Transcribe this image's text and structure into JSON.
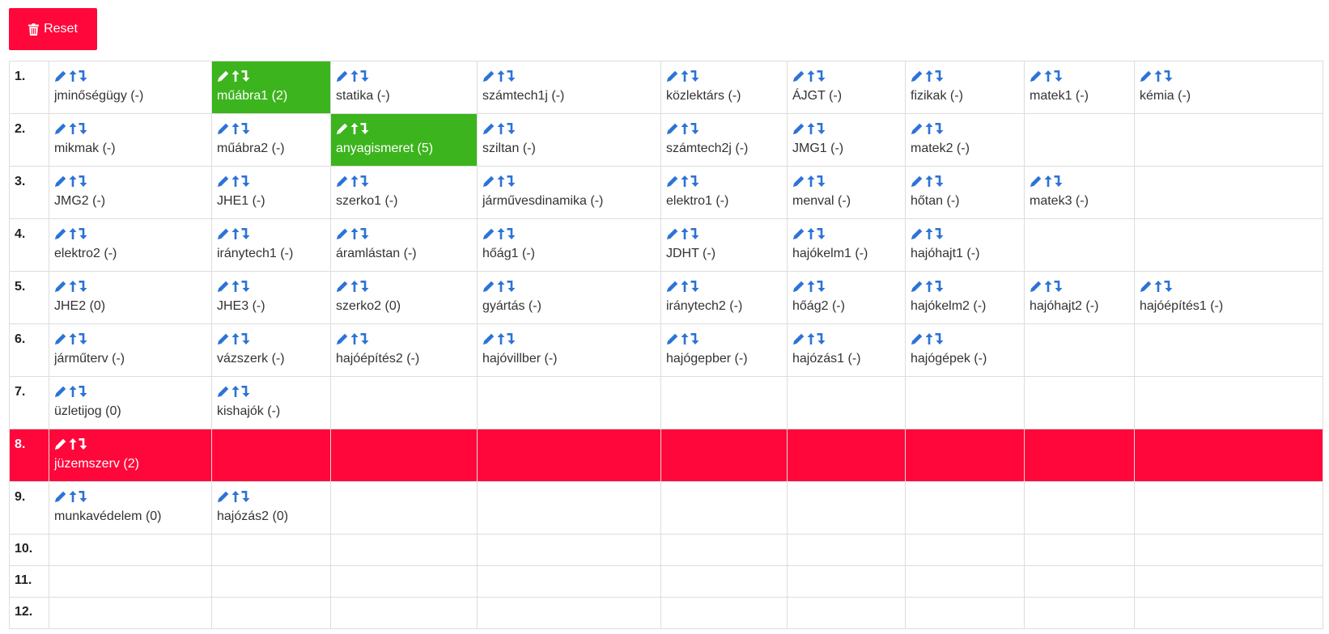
{
  "toolbar": {
    "reset_label": "Reset",
    "reset_color": "#ff073a"
  },
  "colors": {
    "active": "#3cb41d",
    "alert": "#ff073a",
    "icon": "#2c73d6",
    "border": "#dddddd"
  },
  "icons": [
    "pencil-icon",
    "move-up-icon",
    "move-down-icon",
    "trash-icon"
  ],
  "rows": [
    {
      "num": "1.",
      "state": "normal",
      "cells": [
        {
          "name": "jminőségügy",
          "count": "(-)",
          "state": "normal"
        },
        {
          "name": "műábra1",
          "count": "(2)",
          "state": "active"
        },
        {
          "name": "statika",
          "count": "(-)",
          "state": "normal"
        },
        {
          "name": "számtech1j",
          "count": "(-)",
          "state": "normal"
        },
        {
          "name": "közlektárs",
          "count": "(-)",
          "state": "normal"
        },
        {
          "name": "ÁJGT",
          "count": "(-)",
          "state": "normal"
        },
        {
          "name": "fizikak",
          "count": "(-)",
          "state": "normal"
        },
        {
          "name": "matek1",
          "count": "(-)",
          "state": "normal"
        },
        {
          "name": "kémia",
          "count": "(-)",
          "state": "normal"
        }
      ]
    },
    {
      "num": "2.",
      "state": "normal",
      "cells": [
        {
          "name": "mikmak",
          "count": "(-)",
          "state": "normal"
        },
        {
          "name": "műábra2",
          "count": "(-)",
          "state": "normal"
        },
        {
          "name": "anyagismeret",
          "count": "(5)",
          "state": "active"
        },
        {
          "name": "sziltan",
          "count": "(-)",
          "state": "normal"
        },
        {
          "name": "számtech2j",
          "count": "(-)",
          "state": "normal"
        },
        {
          "name": "JMG1",
          "count": "(-)",
          "state": "normal"
        },
        {
          "name": "matek2",
          "count": "(-)",
          "state": "normal"
        }
      ]
    },
    {
      "num": "3.",
      "state": "normal",
      "cells": [
        {
          "name": "JMG2",
          "count": "(-)",
          "state": "normal"
        },
        {
          "name": "JHE1",
          "count": "(-)",
          "state": "normal"
        },
        {
          "name": "szerko1",
          "count": "(-)",
          "state": "normal"
        },
        {
          "name": "járművesdinamika",
          "count": "(-)",
          "state": "normal"
        },
        {
          "name": "elektro1",
          "count": "(-)",
          "state": "normal"
        },
        {
          "name": "menval",
          "count": "(-)",
          "state": "normal"
        },
        {
          "name": "hőtan",
          "count": "(-)",
          "state": "normal"
        },
        {
          "name": "matek3",
          "count": "(-)",
          "state": "normal"
        }
      ]
    },
    {
      "num": "4.",
      "state": "normal",
      "cells": [
        {
          "name": "elektro2",
          "count": "(-)",
          "state": "normal"
        },
        {
          "name": "iránytech1",
          "count": "(-)",
          "state": "normal"
        },
        {
          "name": "áramlástan",
          "count": "(-)",
          "state": "normal"
        },
        {
          "name": "hőág1",
          "count": "(-)",
          "state": "normal"
        },
        {
          "name": "JDHT",
          "count": "(-)",
          "state": "normal"
        },
        {
          "name": "hajókelm1",
          "count": "(-)",
          "state": "normal"
        },
        {
          "name": "hajóhajt1",
          "count": "(-)",
          "state": "normal"
        }
      ]
    },
    {
      "num": "5.",
      "state": "normal",
      "cells": [
        {
          "name": "JHE2",
          "count": "(0)",
          "state": "normal"
        },
        {
          "name": "JHE3",
          "count": "(-)",
          "state": "normal"
        },
        {
          "name": "szerko2",
          "count": "(0)",
          "state": "normal"
        },
        {
          "name": "gyártás",
          "count": "(-)",
          "state": "normal"
        },
        {
          "name": "iránytech2",
          "count": "(-)",
          "state": "normal"
        },
        {
          "name": "hőág2",
          "count": "(-)",
          "state": "normal"
        },
        {
          "name": "hajókelm2",
          "count": "(-)",
          "state": "normal"
        },
        {
          "name": "hajóhajt2",
          "count": "(-)",
          "state": "normal"
        },
        {
          "name": "hajóépítés1",
          "count": "(-)",
          "state": "normal"
        }
      ]
    },
    {
      "num": "6.",
      "state": "normal",
      "cells": [
        {
          "name": "járműterv",
          "count": "(-)",
          "state": "normal"
        },
        {
          "name": "vázszerk",
          "count": "(-)",
          "state": "normal"
        },
        {
          "name": "hajóépítés2",
          "count": "(-)",
          "state": "normal"
        },
        {
          "name": "hajóvillber",
          "count": "(-)",
          "state": "normal"
        },
        {
          "name": "hajógepber",
          "count": "(-)",
          "state": "normal"
        },
        {
          "name": "hajózás1",
          "count": "(-)",
          "state": "normal"
        },
        {
          "name": "hajógépek",
          "count": "(-)",
          "state": "normal"
        }
      ]
    },
    {
      "num": "7.",
      "state": "normal",
      "cells": [
        {
          "name": "üzletijog",
          "count": "(0)",
          "state": "normal"
        },
        {
          "name": "kishajók",
          "count": "(-)",
          "state": "normal"
        }
      ]
    },
    {
      "num": "8.",
      "state": "alert",
      "cells": [
        {
          "name": "jüzemszerv",
          "count": "(2)",
          "state": "alert"
        }
      ]
    },
    {
      "num": "9.",
      "state": "normal",
      "cells": [
        {
          "name": "munkavédelem",
          "count": "(0)",
          "state": "normal"
        },
        {
          "name": "hajózás2",
          "count": "(0)",
          "state": "normal"
        }
      ]
    },
    {
      "num": "10.",
      "state": "normal",
      "cells": []
    },
    {
      "num": "11.",
      "state": "normal",
      "cells": []
    },
    {
      "num": "12.",
      "state": "normal",
      "cells": []
    }
  ]
}
